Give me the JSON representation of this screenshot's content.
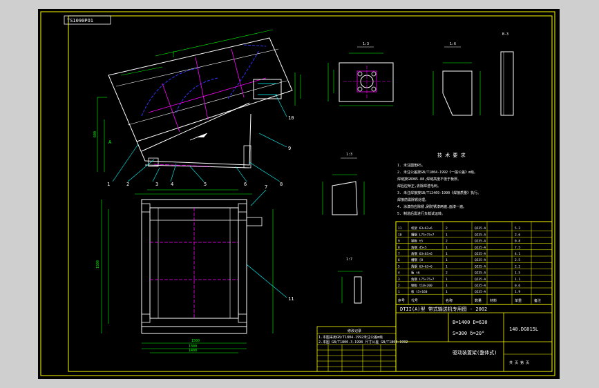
{
  "window": {
    "background": "#cfcfcf"
  },
  "colors": {
    "frame": "#ffff00",
    "part": "#ffffff",
    "dim": "#00ff00",
    "center": "#ff00ff",
    "hidden": "#3333ff",
    "cut": "#00ffff",
    "leader": "#00ffff"
  },
  "drawing": {
    "stamp": "TS1090PO1",
    "views": {
      "v1": {
        "label": "1:3"
      },
      "v2": {
        "label": "1:6"
      },
      "v3": {
        "label": "1:3"
      },
      "v4": {
        "label": "1:7"
      },
      "b3": {
        "label": "B-3"
      }
    },
    "tech_req": {
      "title": "技 术 要 求",
      "lines": [
        "1. 未注圆角R5。",
        "2. 未注公差按GB/T1804-1992《一般公差》m级。",
        "   焊缝按GB985-88,焊缝高度不低于板厚。",
        "   焊后应矫正,去除焊渣毛刺。",
        "3. 未注焊接按GB/T12469-1990《焊接质量》执行。",
        "   焊接前需除锈处理。",
        "4. 涂漆前应除锈,刷防锈漆两遍,面漆一遍。",
        "5. 制造后需进行负载试运转。"
      ]
    },
    "balloons": [
      "1",
      "2",
      "3",
      "4",
      "5",
      "6",
      "8",
      "10",
      "9",
      "7",
      "11"
    ],
    "dims": {
      "frame_len": "1300",
      "width": "1500",
      "height": "600",
      "side": "1500",
      "w1": "1400"
    },
    "parts_list": [
      [
        "11",
        "机架 63×63×6",
        "2",
        "Q235-A",
        "",
        "5.3"
      ],
      [
        "10",
        "槽钢 L75×75×7",
        "1",
        "Q235-A",
        "",
        "2.6"
      ],
      [
        "9",
        "钢板 t5",
        "2",
        "Q235-A",
        "",
        "0.8"
      ],
      [
        "8",
        "角钢 45×5",
        "1",
        "Q235-A",
        "",
        "7.5"
      ],
      [
        "7",
        "角钢 63×63×6",
        "1",
        "Q235-A",
        "",
        "4.1"
      ],
      [
        "6",
        "槽钢 [8",
        "1",
        "Q235-A",
        "",
        "2.5"
      ],
      [
        "5",
        "角钢 63×63×6",
        "1",
        "Q235-A",
        "",
        "2.2"
      ],
      [
        "4",
        "板 t6",
        "2",
        "Q235-A",
        "",
        "1.5"
      ],
      [
        "3",
        "角钢 L75×75×7",
        "1",
        "Q235-A",
        "",
        "1.1"
      ],
      [
        "2",
        "钢板 t10×200",
        "1",
        "Q235-A",
        "",
        "0.6"
      ],
      [
        "1",
        "板 t5×160",
        "1",
        "Q235-A",
        "",
        "1.9"
      ]
    ],
    "parts_header": [
      "序号",
      "代号",
      "名称",
      "数量",
      "材料",
      "单重",
      "备注"
    ],
    "title_block": {
      "line1": "DTII(A)型  带式输送机专用图 - 2002",
      "spec1": "B=1400 D=630",
      "spec2": "S=300 δ=20°",
      "code": "140.DG015L",
      "name": "驱动装置架(整体式)",
      "sheet": "共 页  第 页"
    },
    "revision": {
      "title": "修改记录",
      "rows": [
        "1.本图采用GB/T1804-1992未注公差m级",
        "2.本图 GB/T1800.3-1998 尺寸公差 GB/T1804-1992"
      ]
    },
    "slope_label": "A"
  }
}
